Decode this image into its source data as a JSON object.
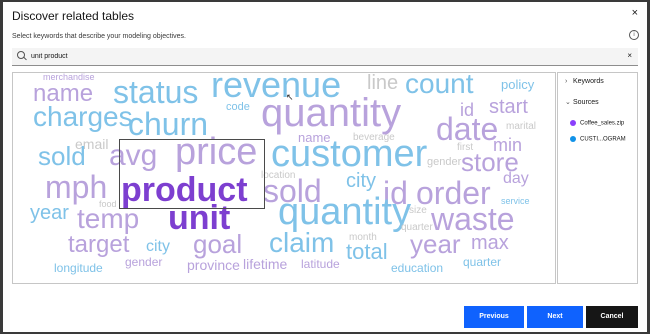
{
  "dialog": {
    "title": "Discover related tables",
    "close_glyph": "×",
    "subtitle": "Select keywords that describe your modeling objectives.",
    "info_glyph": "i"
  },
  "search": {
    "value": "unit product",
    "icon": "search-icon",
    "clear_glyph": "×"
  },
  "word_cloud": [
    {
      "text": "merchandise",
      "color": "lp"
    },
    {
      "text": "revenue",
      "color": "lb"
    },
    {
      "text": "line",
      "color": "gr"
    },
    {
      "text": "count",
      "color": "lb"
    },
    {
      "text": "policy",
      "color": "lb"
    },
    {
      "text": "name",
      "color": "lp"
    },
    {
      "text": "status",
      "color": "lb"
    },
    {
      "text": "quantity",
      "color": "lp"
    },
    {
      "text": "charges",
      "color": "lb"
    },
    {
      "text": "code",
      "color": "lb"
    },
    {
      "text": "id",
      "color": "lp"
    },
    {
      "text": "start",
      "color": "lp"
    },
    {
      "text": "churn",
      "color": "lb"
    },
    {
      "text": "date",
      "color": "lp"
    },
    {
      "text": "marital",
      "color": "gr"
    },
    {
      "text": "email",
      "color": "gr"
    },
    {
      "text": "name",
      "color": "lp"
    },
    {
      "text": "beverage",
      "color": "gr"
    },
    {
      "text": "first",
      "color": "gr"
    },
    {
      "text": "min",
      "color": "lp"
    },
    {
      "text": "sold",
      "color": "lb"
    },
    {
      "text": "avg",
      "color": "lp"
    },
    {
      "text": "price",
      "color": "lp"
    },
    {
      "text": "customer",
      "color": "lb"
    },
    {
      "text": "gender",
      "color": "gr"
    },
    {
      "text": "store",
      "color": "lp"
    },
    {
      "text": "mph",
      "color": "lp"
    },
    {
      "text": "product",
      "color": "dp"
    },
    {
      "text": "location",
      "color": "gr"
    },
    {
      "text": "city",
      "color": "lb"
    },
    {
      "text": "day",
      "color": "lp"
    },
    {
      "text": "sold",
      "color": "lp"
    },
    {
      "text": "id",
      "color": "lp"
    },
    {
      "text": "order",
      "color": "lp"
    },
    {
      "text": "year",
      "color": "lb"
    },
    {
      "text": "food",
      "color": "gr"
    },
    {
      "text": "service",
      "color": "lb"
    },
    {
      "text": "temp",
      "color": "lp"
    },
    {
      "text": "unit",
      "color": "dp"
    },
    {
      "text": "quantity",
      "color": "lb"
    },
    {
      "text": "size",
      "color": "gr"
    },
    {
      "text": "waste",
      "color": "lp"
    },
    {
      "text": "target",
      "color": "lp"
    },
    {
      "text": "city",
      "color": "lb"
    },
    {
      "text": "goal",
      "color": "lp"
    },
    {
      "text": "claim",
      "color": "lb"
    },
    {
      "text": "month",
      "color": "gr"
    },
    {
      "text": "quarter",
      "color": "gr"
    },
    {
      "text": "year",
      "color": "lp"
    },
    {
      "text": "max",
      "color": "lp"
    },
    {
      "text": "total",
      "color": "lb"
    },
    {
      "text": "longitude",
      "color": "lb"
    },
    {
      "text": "gender",
      "color": "lp"
    },
    {
      "text": "province",
      "color": "lp"
    },
    {
      "text": "lifetime",
      "color": "lp"
    },
    {
      "text": "latitude",
      "color": "lp"
    },
    {
      "text": "education",
      "color": "lb"
    },
    {
      "text": "quarter",
      "color": "lb"
    }
  ],
  "sidebar": {
    "keywords_label": "Keywords",
    "sources_label": "Sources",
    "sources": [
      {
        "name": "Coffee_sales.zip",
        "color": "#8a3ffc"
      },
      {
        "name": "CUSTI...OGRAM",
        "color": "#1192e8"
      }
    ]
  },
  "footer": {
    "previous_label": "Previous",
    "next_label": "Next",
    "cancel_label": "Cancel"
  },
  "colors": {
    "primary": "#0f62fe",
    "dark_button": "#161616",
    "highlight_word": "#7d3fd0"
  }
}
